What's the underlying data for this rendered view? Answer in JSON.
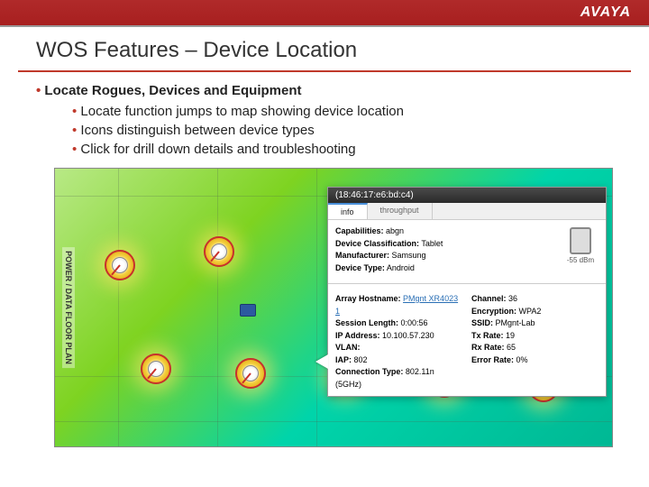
{
  "header": {
    "logo": "AVAYA"
  },
  "title": "WOS Features – Device Location",
  "bullets": {
    "main": "Locate Rogues, Devices and Equipment",
    "sub1": "Locate function jumps to map showing device location",
    "sub2": "Icons distinguish between device types",
    "sub3": "Click for drill down details and troubleshooting"
  },
  "floorplan_label": "POWER / DATA FLOOR PLAN",
  "popup": {
    "title_mac": "(18:46:17:e6:bd:c4)",
    "tabs": {
      "info": "info",
      "throughput": "throughput"
    },
    "capabilities_label": "Capabilities:",
    "capabilities": "abgn",
    "class_label": "Device Classification:",
    "class": "Tablet",
    "mfr_label": "Manufacturer:",
    "mfr": "Samsung",
    "type_label": "Device Type:",
    "type": "Android",
    "signal": "-55 dBm",
    "host_label": "Array Hostname:",
    "host": "PMgnt XR4023 1",
    "session_label": "Session Length:",
    "session": "0:00:56",
    "ip_label": "IP Address:",
    "ip": "10.100.57.230",
    "vlan_label": "VLAN:",
    "vlan": "",
    "iap_label": "IAP:",
    "iap": "802",
    "conn_label": "Connection Type:",
    "conn": "802.11n (5GHz)",
    "channel_label": "Channel:",
    "channel": "36",
    "enc_label": "Encryption:",
    "enc": "WPA2",
    "ssid_label": "SSID:",
    "ssid": "PMgnt-Lab",
    "tx_label": "Tx Rate:",
    "tx": "19",
    "rx_label": "Rx Rate:",
    "rx": "65",
    "err_label": "Error Rate:",
    "err": "0%"
  }
}
